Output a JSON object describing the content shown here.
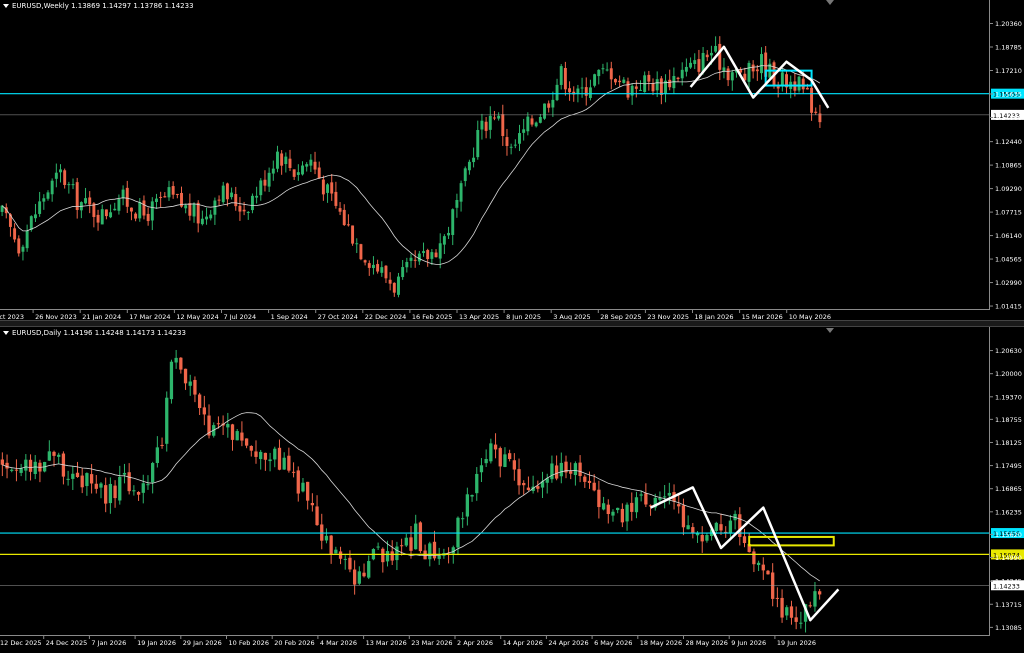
{
  "colors": {
    "background": "#000000",
    "bull": "#2db56b",
    "bear": "#f0664a",
    "ma": "#d8d8d8",
    "cyan": "#00e5ff",
    "yellow": "#e8e800",
    "pattern": "#ffffff",
    "price_line": "#a0a0a0",
    "axis_text": "#ffffff"
  },
  "chart_data": [
    {
      "type": "candlestick",
      "title": "EURUSD,Weekly  1.13869 1.14297 1.13786 1.14233",
      "ylim": [
        1.0115,
        1.214
      ],
      "y_ticks": [
        "1.20360",
        "1.18785",
        "1.17210",
        "1.15635",
        "1.14060",
        "1.12440",
        "1.10865",
        "1.09290",
        "1.07715",
        "1.06140",
        "1.04565",
        "1.02990",
        "1.01415"
      ],
      "x_labels": [
        "4 Oct 2023",
        "26 Nov 2023",
        "21 Jan 2024",
        "17 Mar 2024",
        "12 May 2024",
        "7 Jul 2024",
        "1 Sep 2024",
        "27 Oct 2024",
        "22 Dec 2024",
        "16 Feb 2025",
        "13 Apr 2025",
        "8 Jun 2025",
        "3 Aug 2025",
        "28 Sep 2025",
        "23 Nov 2025",
        "18 Jan 2026",
        "15 Mar 2026",
        "10 May 2026"
      ],
      "x_label_display": [
        "4 Oct 2023"
      ],
      "keypoints": [
        [
          0,
          1.076
        ],
        [
          4,
          1.055
        ],
        [
          10,
          1.088
        ],
        [
          14,
          1.103
        ],
        [
          18,
          1.085
        ],
        [
          24,
          1.075
        ],
        [
          28,
          1.088
        ],
        [
          34,
          1.075
        ],
        [
          40,
          1.088
        ],
        [
          48,
          1.072
        ],
        [
          52,
          1.092
        ],
        [
          58,
          1.08
        ],
        [
          62,
          1.095
        ],
        [
          66,
          1.118
        ],
        [
          70,
          1.105
        ],
        [
          74,
          1.112
        ],
        [
          78,
          1.09
        ],
        [
          82,
          1.072
        ],
        [
          86,
          1.052
        ],
        [
          90,
          1.04
        ],
        [
          94,
          1.028
        ],
        [
          98,
          1.04
        ],
        [
          103,
          1.05
        ],
        [
          106,
          1.06
        ],
        [
          110,
          1.09
        ],
        [
          114,
          1.13
        ],
        [
          118,
          1.145
        ],
        [
          122,
          1.118
        ],
        [
          126,
          1.135
        ],
        [
          130,
          1.148
        ],
        [
          134,
          1.17
        ],
        [
          138,
          1.155
        ],
        [
          142,
          1.168
        ],
        [
          146,
          1.172
        ],
        [
          150,
          1.16
        ],
        [
          154,
          1.165
        ],
        [
          158,
          1.162
        ],
        [
          162,
          1.17
        ],
        [
          166,
          1.175
        ],
        [
          170,
          1.185
        ],
        [
          174,
          1.172
        ],
        [
          178,
          1.168
        ],
        [
          182,
          1.178
        ],
        [
          186,
          1.165
        ],
        [
          190,
          1.165
        ],
        [
          194,
          1.15
        ],
        [
          196,
          1.142
        ]
      ],
      "n": 197,
      "last_price": "1.14233",
      "levels": [
        {
          "value": 1.15656,
          "label": "1.15656",
          "color": "cyan"
        }
      ],
      "zones": [
        {
          "x0": 183,
          "x1": 194,
          "y0": 1.162,
          "y1": 1.172,
          "color": "cyan"
        }
      ],
      "pattern": [
        [
          165,
          1.161
        ],
        [
          173,
          1.188
        ],
        [
          180,
          1.154
        ],
        [
          188,
          1.178
        ],
        [
          194,
          1.1655
        ],
        [
          198,
          1.147
        ]
      ]
    },
    {
      "type": "candlestick",
      "title": "EURUSD,Daily  1.14196 1.14248 1.14173 1.14233",
      "ylim": [
        1.1285,
        1.21
      ],
      "y_ticks": [
        "1.20630",
        "1.20000",
        "1.19370",
        "1.18755",
        "1.18125",
        "1.17495",
        "1.16865",
        "1.16235",
        "1.15620",
        "1.14990",
        "1.14345",
        "1.13715",
        "1.13085"
      ],
      "x_labels": [
        "12 Dec 2025",
        "24 Dec 2025",
        "7 Jan 2026",
        "19 Jan 2026",
        "29 Jan 2026",
        "10 Feb 2026",
        "20 Feb 2026",
        "4 Mar 2026",
        "13 Mar 2026",
        "23 Mar 2026",
        "2 Apr 2026",
        "14 Apr 2026",
        "24 Apr 2026",
        "6 May 2026",
        "18 May 2026",
        "28 May 2026",
        "9 Jun 2026",
        "19 Jun 2026"
      ],
      "keypoints": [
        [
          0,
          1.176
        ],
        [
          6,
          1.174
        ],
        [
          10,
          1.178
        ],
        [
          16,
          1.172
        ],
        [
          22,
          1.166
        ],
        [
          26,
          1.17
        ],
        [
          30,
          1.168
        ],
        [
          34,
          1.183
        ],
        [
          36,
          1.205
        ],
        [
          40,
          1.196
        ],
        [
          44,
          1.183
        ],
        [
          48,
          1.186
        ],
        [
          52,
          1.181
        ],
        [
          56,
          1.178
        ],
        [
          60,
          1.175
        ],
        [
          64,
          1.168
        ],
        [
          68,
          1.155
        ],
        [
          72,
          1.148
        ],
        [
          76,
          1.144
        ],
        [
          80,
          1.152
        ],
        [
          84,
          1.15
        ],
        [
          88,
          1.156
        ],
        [
          92,
          1.149
        ],
        [
          96,
          1.155
        ],
        [
          100,
          1.17
        ],
        [
          104,
          1.178
        ],
        [
          108,
          1.174
        ],
        [
          112,
          1.168
        ],
        [
          116,
          1.172
        ],
        [
          120,
          1.176
        ],
        [
          124,
          1.172
        ],
        [
          128,
          1.164
        ],
        [
          132,
          1.162
        ],
        [
          136,
          1.165
        ],
        [
          140,
          1.168
        ],
        [
          144,
          1.162
        ],
        [
          148,
          1.154
        ],
        [
          152,
          1.157
        ],
        [
          156,
          1.16
        ],
        [
          160,
          1.15
        ],
        [
          164,
          1.14
        ],
        [
          168,
          1.132
        ],
        [
          171,
          1.136
        ],
        [
          174,
          1.142
        ]
      ],
      "n": 175,
      "last_price": "1.14233",
      "levels": [
        {
          "value": 1.15656,
          "label": "1.15656",
          "color": "cyan"
        },
        {
          "value": 1.15074,
          "label": "1.15074",
          "color": "yellow"
        }
      ],
      "zones": [
        {
          "x0": 159,
          "x1": 177,
          "y0": 1.1532,
          "y1": 1.1555,
          "color": "yellow"
        }
      ],
      "pattern": [
        [
          138,
          1.1635
        ],
        [
          147,
          1.169
        ],
        [
          153,
          1.1525
        ],
        [
          162,
          1.1635
        ],
        [
          172,
          1.1328
        ],
        [
          178,
          1.1412
        ]
      ]
    }
  ]
}
